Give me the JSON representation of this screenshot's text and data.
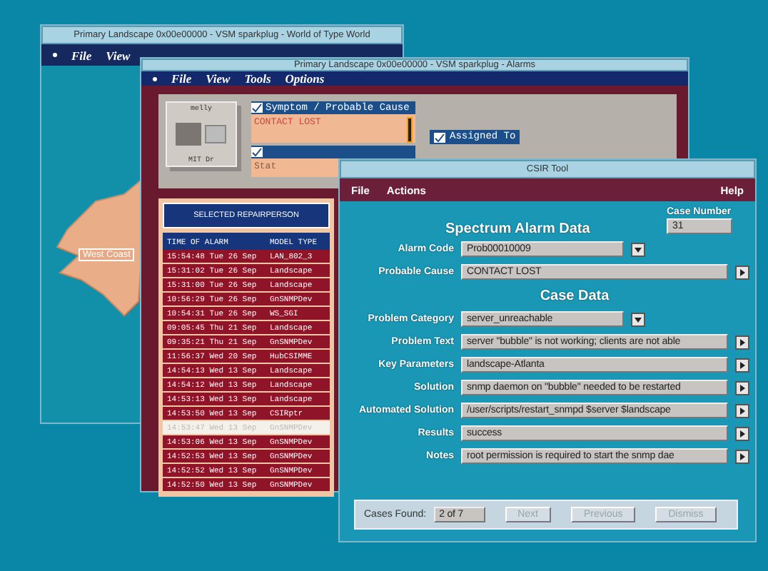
{
  "map_window": {
    "title": "Primary Landscape 0x00e00000 - VSM sparkplug - World of Type World",
    "menu": [
      "File",
      "View"
    ],
    "map_label": "West Coast"
  },
  "alarms_window": {
    "title": "Primary Landscape 0x00e00000 - VSM sparkplug - Alarms",
    "menu": [
      "File",
      "View",
      "Tools",
      "Options"
    ],
    "device": {
      "name": "melly",
      "address": "MIT Dr"
    },
    "symptom": {
      "title": "Symptom / Probable Cause",
      "text": "CONTACT LOST"
    },
    "assigned": {
      "title": "Assigned To"
    },
    "status": {
      "text": "Stat"
    },
    "repair": {
      "title": "SELECTED REPAIRPERSON",
      "columns": [
        "TIME OF ALARM",
        "MODEL TYPE"
      ],
      "rows": [
        {
          "time": "15:54:48 Tue 26 Sep",
          "model": "LAN_802_3",
          "selected": false
        },
        {
          "time": "15:31:02 Tue 26 Sep",
          "model": "Landscape",
          "selected": false
        },
        {
          "time": "15:31:00 Tue 26 Sep",
          "model": "Landscape",
          "selected": false
        },
        {
          "time": "10:56:29 Tue 26 Sep",
          "model": "GnSNMPDev",
          "selected": false
        },
        {
          "time": "10:54:31 Tue 26 Sep",
          "model": "WS_SGI",
          "selected": false
        },
        {
          "time": "09:05:45 Thu 21 Sep",
          "model": "Landscape",
          "selected": false
        },
        {
          "time": "09:35:21 Thu 21 Sep",
          "model": "GnSNMPDev",
          "selected": false
        },
        {
          "time": "11:56:37 Wed 20 Sep",
          "model": "HubCSIMME",
          "selected": false
        },
        {
          "time": "14:54:13 Wed 13 Sep",
          "model": "Landscape",
          "selected": false
        },
        {
          "time": "14:54:12 Wed 13 Sep",
          "model": "Landscape",
          "selected": false
        },
        {
          "time": "14:53:13 Wed 13 Sep",
          "model": "Landscape",
          "selected": false
        },
        {
          "time": "14:53:50 Wed 13 Sep",
          "model": "CSIRptr",
          "selected": false
        },
        {
          "time": "14:53:47 Wed 13 Sep",
          "model": "GnSNMPDev",
          "selected": true
        },
        {
          "time": "14:53:06 Wed 13 Sep",
          "model": "GnSNMPDev",
          "selected": false
        },
        {
          "time": "14:52:53 Wed 13 Sep",
          "model": "GnSNMPDev",
          "selected": false
        },
        {
          "time": "14:52:52 Wed 13 Sep",
          "model": "GnSNMPDev",
          "selected": false
        },
        {
          "time": "14:52:50 Wed 13 Sep",
          "model": "GnSNMPDev",
          "selected": false
        }
      ]
    }
  },
  "csir_window": {
    "title": "CSIR Tool",
    "menu": [
      "File",
      "Actions"
    ],
    "help": "Help",
    "heading": "Spectrum Alarm Data",
    "case_number": {
      "label": "Case Number",
      "value": "31"
    },
    "alarm_fields": [
      {
        "label": "Alarm Code",
        "value": "Prob00010009",
        "kind": "dropdown"
      },
      {
        "label": "Probable Cause",
        "value": "CONTACT LOST",
        "kind": "expand"
      }
    ],
    "case_heading": "Case Data",
    "case_fields": [
      {
        "label": "Problem Category",
        "value": "server_unreachable",
        "kind": "dropdown"
      },
      {
        "label": "Problem Text",
        "value": "server \"bubble\" is not working; clients are not able",
        "kind": "expand"
      },
      {
        "label": "Key Parameters",
        "value": "landscape-Atlanta",
        "kind": "expand"
      },
      {
        "label": "Solution",
        "value": "snmp daemon on \"bubble\" needed to be restarted",
        "kind": "expand"
      },
      {
        "label": "Automated Solution",
        "value": "/user/scripts/restart_snmpd $server $landscape",
        "kind": "expand"
      },
      {
        "label": "Results",
        "value": "success",
        "kind": "expand"
      },
      {
        "label": "Notes",
        "value": "root permission is required to start the snmp dae",
        "kind": "expand"
      }
    ],
    "footer": {
      "label": "Cases Found:",
      "value": "2 of 7",
      "buttons": [
        {
          "label": "Next",
          "disabled": true
        },
        {
          "label": "Previous",
          "disabled": true
        },
        {
          "label": "Dismiss",
          "disabled": true
        }
      ]
    }
  }
}
